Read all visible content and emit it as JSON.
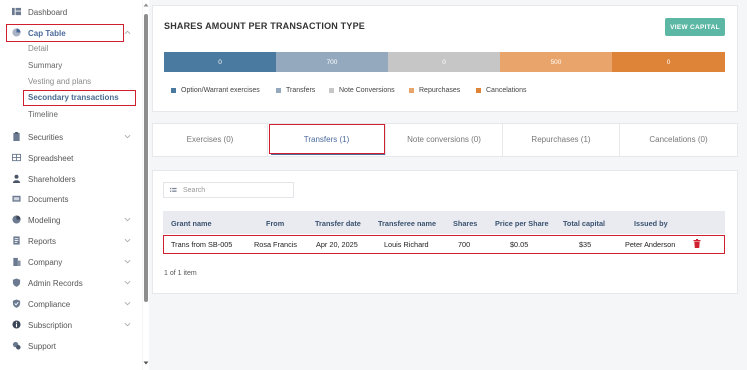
{
  "sidebar": {
    "items": [
      {
        "label": "Dashboard",
        "icon": "dashboard-icon"
      },
      {
        "label": "Cap Table",
        "icon": "pie-chart-icon"
      },
      {
        "label": "Securities",
        "icon": "clipboard-icon"
      },
      {
        "label": "Spreadsheet",
        "icon": "grid-icon"
      },
      {
        "label": "Shareholders",
        "icon": "person-icon"
      },
      {
        "label": "Documents",
        "icon": "document-icon"
      },
      {
        "label": "Modeling",
        "icon": "chart-icon"
      },
      {
        "label": "Reports",
        "icon": "report-icon"
      },
      {
        "label": "Company",
        "icon": "building-icon"
      },
      {
        "label": "Admin Records",
        "icon": "shield-icon"
      },
      {
        "label": "Compliance",
        "icon": "check-shield-icon"
      },
      {
        "label": "Subscription",
        "icon": "info-icon"
      },
      {
        "label": "Support",
        "icon": "support-icon"
      }
    ],
    "cap_table_sub": [
      {
        "label": "Detail"
      },
      {
        "label": "Summary"
      },
      {
        "label": "Vesting and plans"
      },
      {
        "label": "Secondary transactions"
      },
      {
        "label": "Timeline"
      }
    ]
  },
  "summary": {
    "title": "SHARES AMOUNT PER TRANSACTION TYPE",
    "view_button": "VIEW CAPITAL",
    "colors": {
      "option": "#4a7aa0",
      "transfers": "#94a9bd",
      "note": "#c6c6c6",
      "repurchases": "#e8a46a",
      "cancelations": "#dd8438"
    },
    "bar_values": [
      "0",
      "700",
      "0",
      "500",
      "0"
    ],
    "legend": [
      "Option/Warrant exercises",
      "Transfers",
      "Note Conversions",
      "Repurchases",
      "Cancelations"
    ]
  },
  "tabs": [
    {
      "label": "Exercises (0)"
    },
    {
      "label": "Transfers (1)"
    },
    {
      "label": "Note conversions (0)"
    },
    {
      "label": "Repurchases (1)"
    },
    {
      "label": "Cancelations (0)"
    }
  ],
  "search": {
    "placeholder": "Search"
  },
  "table": {
    "headers": [
      "Grant name",
      "From",
      "Transfer date",
      "Transferee name",
      "Shares",
      "Price per Share",
      "Total capital",
      "Issued by"
    ],
    "rows": [
      [
        "Trans from SB-005",
        "Rosa Francis",
        "Apr 20, 2025",
        "Louis Richard",
        "700",
        "$0.05",
        "$35",
        "Peter Anderson"
      ]
    ]
  },
  "pagination": {
    "text": "1 of 1 item"
  }
}
